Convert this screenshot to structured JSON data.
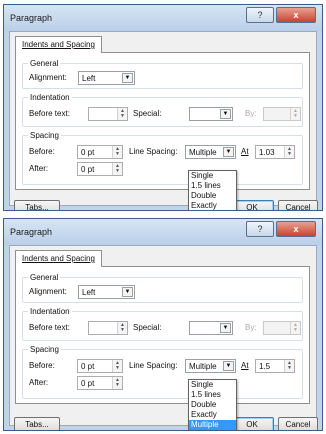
{
  "dialog": {
    "title": "Paragraph",
    "help_label": "?",
    "close_label": "x",
    "tab_label": "Indents and Spacing",
    "groups": {
      "general": "General",
      "indentation": "Indentation",
      "spacing": "Spacing"
    },
    "labels": {
      "alignment": "Alignment:",
      "before_text": "Before text:",
      "special": "Special:",
      "by": "By:",
      "before": "Before:",
      "after": "After:",
      "line_spacing": "Line Spacing:",
      "at": "At"
    },
    "buttons": {
      "tabs": "Tabs...",
      "ok": "OK",
      "cancel": "Cancel"
    },
    "line_spacing_options": [
      "Single",
      "1.5 lines",
      "Double",
      "Exactly",
      "Multiple"
    ]
  },
  "screens": [
    {
      "alignment": "Left",
      "before_text": "",
      "special": "",
      "by": "",
      "before": "0 pt",
      "after": "0 pt",
      "line_spacing": "Multiple",
      "at": "1.03",
      "highlighted_option": ""
    },
    {
      "alignment": "Left",
      "before_text": "",
      "special": "",
      "by": "",
      "before": "0 pt",
      "after": "0 pt",
      "line_spacing": "Multiple",
      "at": "1.5",
      "highlighted_option": "Multiple"
    }
  ]
}
